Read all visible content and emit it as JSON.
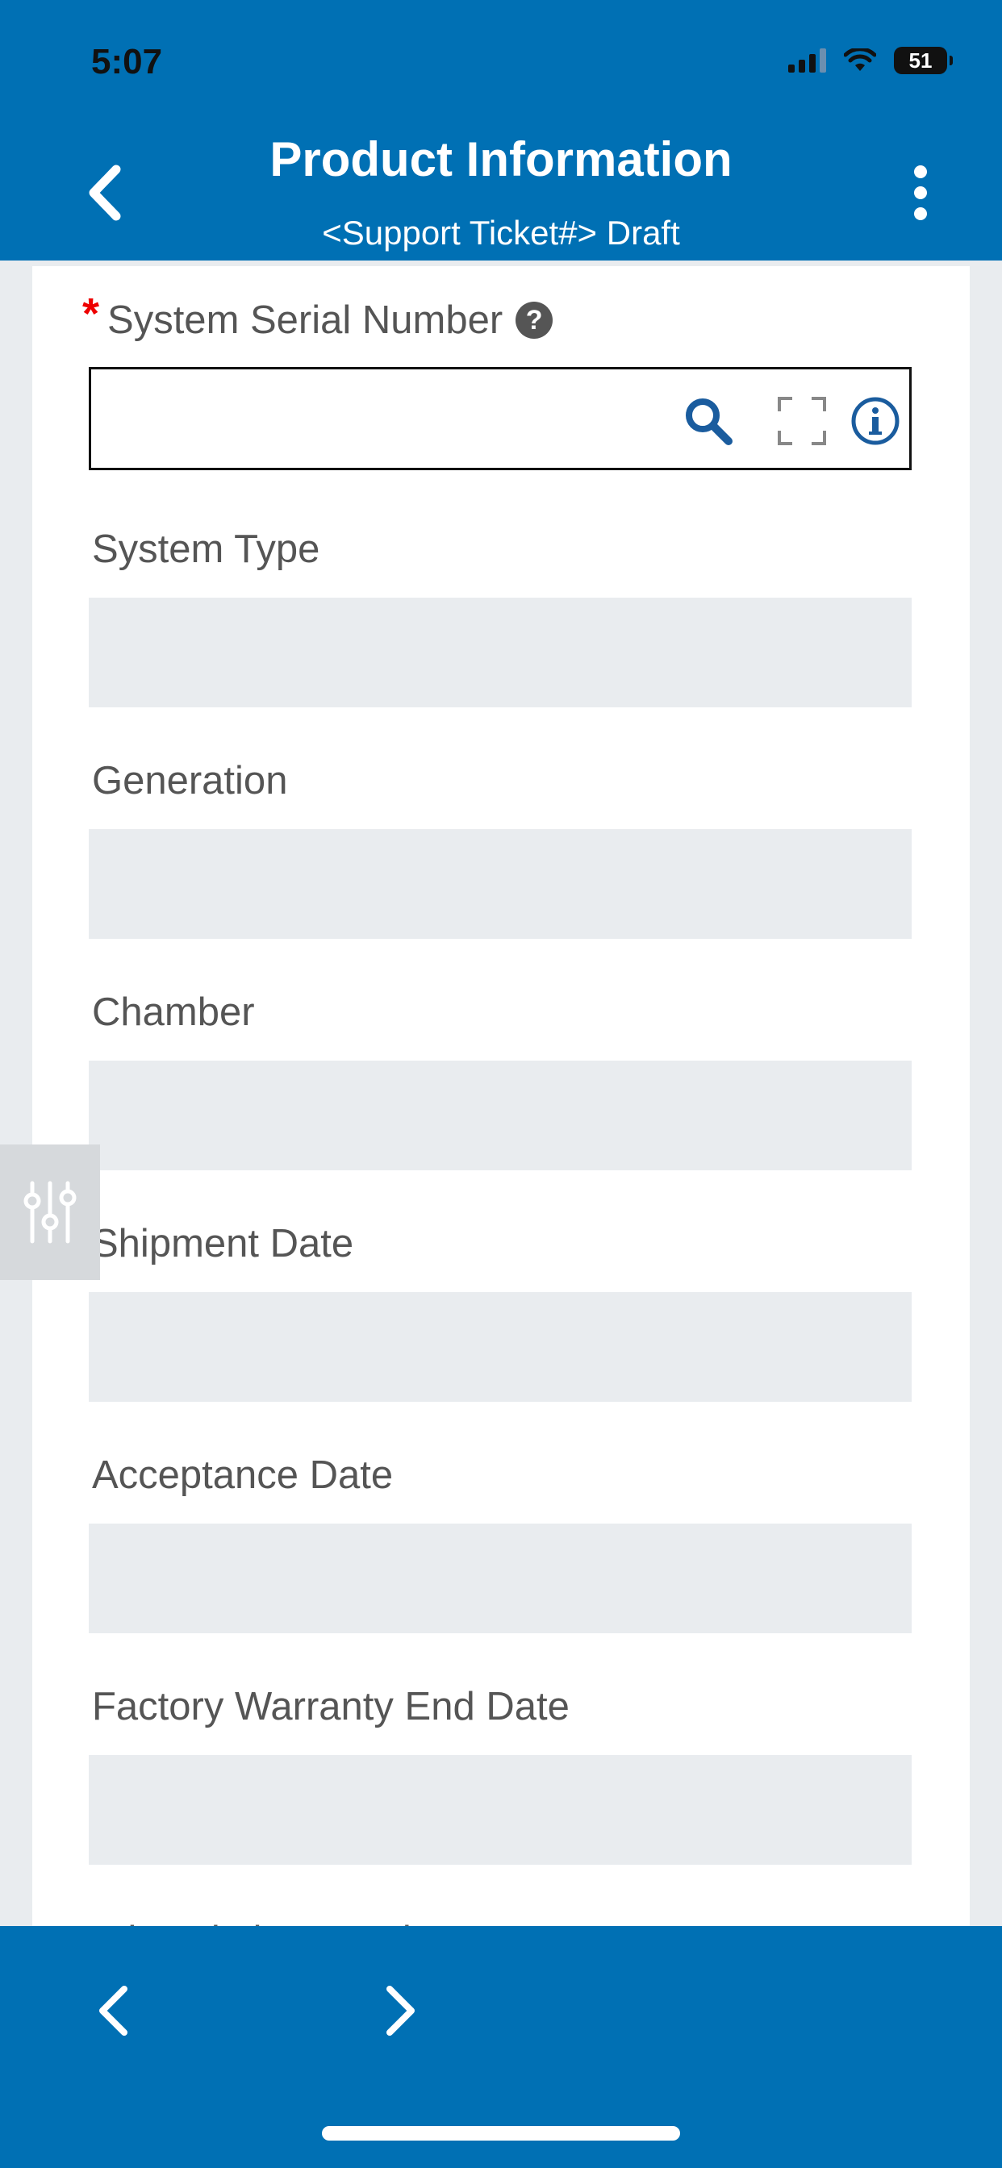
{
  "status_bar": {
    "time": "5:07",
    "battery_level": "51"
  },
  "header": {
    "title": "Product Information",
    "subtitle": "<Support Ticket#> Draft",
    "back_icon": "chevron-left-icon",
    "menu_icon": "more-vertical-icon"
  },
  "form": {
    "serial_number": {
      "label": "System Serial Number",
      "required": true,
      "value": "",
      "placeholder": "",
      "icons": [
        "search-icon",
        "scan-icon",
        "info-icon"
      ]
    },
    "fields": [
      {
        "label": "System Type",
        "value": ""
      },
      {
        "label": "Generation",
        "value": ""
      },
      {
        "label": "Chamber",
        "value": ""
      },
      {
        "label": "Shipment Date",
        "value": ""
      },
      {
        "label": "Acceptance Date",
        "value": ""
      },
      {
        "label": "Factory Warranty End Date",
        "value": ""
      }
    ],
    "next_label_partial": "Fault Isolation Level"
  },
  "footer": {
    "prev_icon": "chevron-left-icon",
    "next_icon": "chevron-right-icon"
  },
  "colors": {
    "brand_blue": "#0070b4",
    "required_red": "#e00000",
    "field_gray": "#e9ecef"
  }
}
